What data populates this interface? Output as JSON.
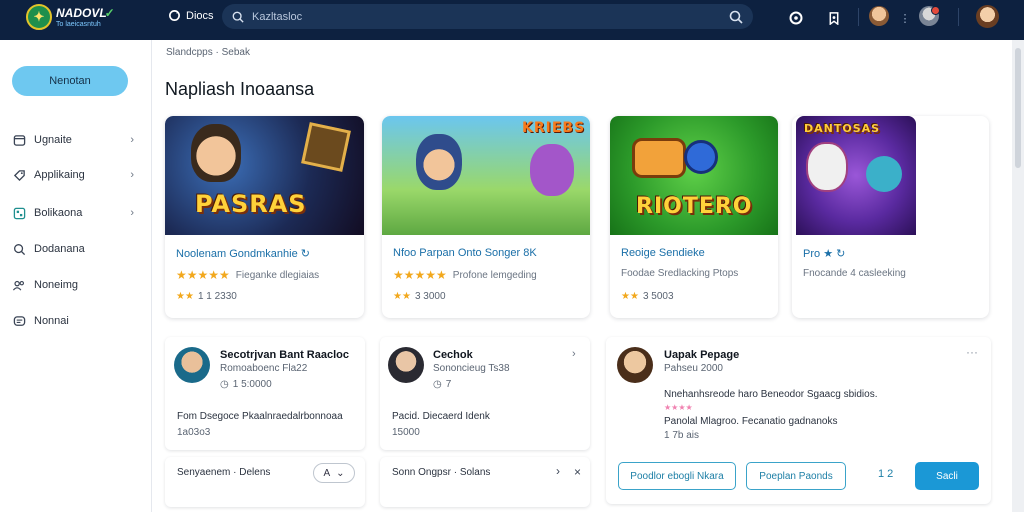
{
  "header": {
    "logo_title": "NADOVL",
    "logo_sub": "To  laeicasntuh",
    "apps_label": "Diocs",
    "search_placeholder": "Kazltasloc"
  },
  "sidebar": {
    "primary_button": "Nenotan",
    "items": [
      {
        "label": "Ugnaite",
        "icon": "window-icon",
        "chevron": true
      },
      {
        "label": "Applikaing",
        "icon": "tag-icon",
        "chevron": true
      },
      {
        "label": "Bolikaona",
        "icon": "grid-icon",
        "chevron": true
      },
      {
        "label": "Dodanana",
        "icon": "search-icon",
        "chevron": false
      },
      {
        "label": "Noneimg",
        "icon": "people-icon",
        "chevron": false
      },
      {
        "label": "Nonnai",
        "icon": "chat-icon",
        "chevron": false
      }
    ]
  },
  "main": {
    "breadcrumb": "Slandcpps · Sebak",
    "title": "Napliash Inoaansa",
    "games": [
      {
        "art_text": "PASRAS",
        "name": "Noolenam Gondmkanhie",
        "subtitle": "Fieganke dlegiaias",
        "stars": "★★★★★",
        "meta_stars": "★★",
        "meta": "1 1 2330"
      },
      {
        "art_text": "KRIEBS",
        "name": "Nfoo Parpan Onto Songer",
        "name_suffix": "8K",
        "subtitle": "Profone lemgeding",
        "stars": "★★★★★",
        "meta_stars": "★★",
        "meta": "3 3000"
      },
      {
        "art_text": "RIOTERO",
        "name": "Reoige Sendieke",
        "subtitle": "Foodae Sredlacking Ptops",
        "stars": "",
        "meta_stars": "★★",
        "meta": "3 5003"
      },
      {
        "art_text": "DANTOSAS",
        "name": "Pro",
        "subtitle": "Fnocande 4 casleeking",
        "stars": "",
        "meta_stars": "",
        "meta": ""
      }
    ],
    "panels": [
      {
        "name": "Secotrjvan Bant Raacloc",
        "sub": "Romoaboenc Fla22",
        "meta": "1  5:0000",
        "body": "Fom Dsegoce Pkaalnraedalrbonnoaa",
        "body2": "1a03o3"
      },
      {
        "name": "Cechok",
        "sub": "Sononcieug Ts38",
        "meta": "7",
        "body": "Pacid. Diecaerd Idenk",
        "body2": "15000"
      },
      {
        "name": "Uapak Pepage",
        "sub": "Pahseu 2000",
        "body": "Nnehanhsreode haro Beneodor Sgaacg sbidios.",
        "body_stars": "★★★★",
        "body2": "Panolal Mlagroo. Fecanatio gadnanoks",
        "meta": "1 7b ais"
      }
    ],
    "bottom_panels": [
      {
        "label": "Senyaenem · Delens",
        "select": "A"
      },
      {
        "label": "Sonn Ongpsr · Solans"
      }
    ],
    "actions": {
      "outline1": "Poodlor ebogli Nkara",
      "outline2": "Poeplan Paonds",
      "count": "1  2",
      "primary": "Sacli"
    }
  }
}
